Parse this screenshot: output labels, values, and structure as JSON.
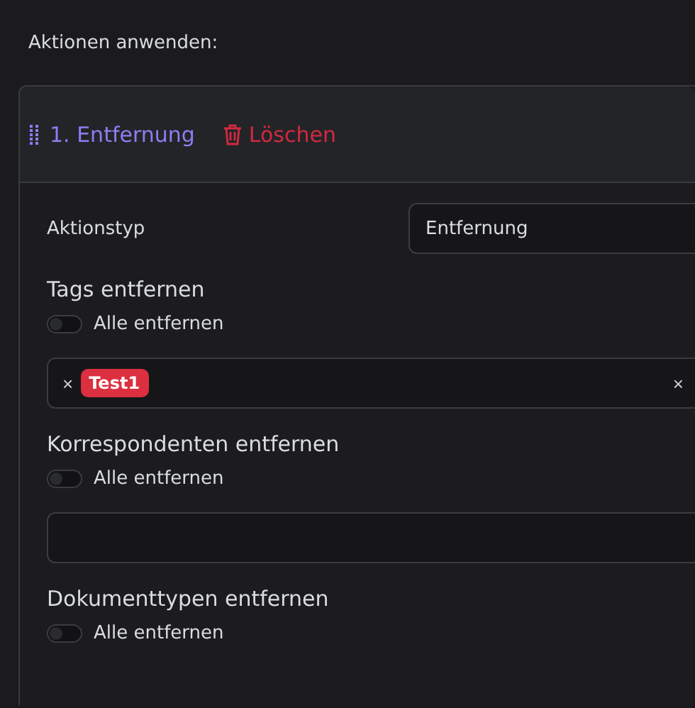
{
  "heading": "Aktionen anwenden:",
  "action": {
    "title": "1. Entfernung",
    "delete_label": "Löschen",
    "type_field": {
      "label": "Aktionstyp",
      "value": "Entfernung"
    },
    "sections": [
      {
        "title": "Tags entfernen",
        "toggle": {
          "label": "Alle entfernen",
          "on": false
        },
        "field": {
          "kind": "multiselect",
          "tags": [
            {
              "remove": "×",
              "label": "Test1",
              "color": "#dc2f3f"
            }
          ],
          "clear": "×"
        }
      },
      {
        "title": "Korrespondenten entfernen",
        "toggle": {
          "label": "Alle entfernen",
          "on": false
        },
        "field": {
          "kind": "multiselect"
        }
      },
      {
        "title": "Dokumenttypen entfernen",
        "toggle": {
          "label": "Alle entfernen",
          "on": false
        }
      }
    ]
  }
}
